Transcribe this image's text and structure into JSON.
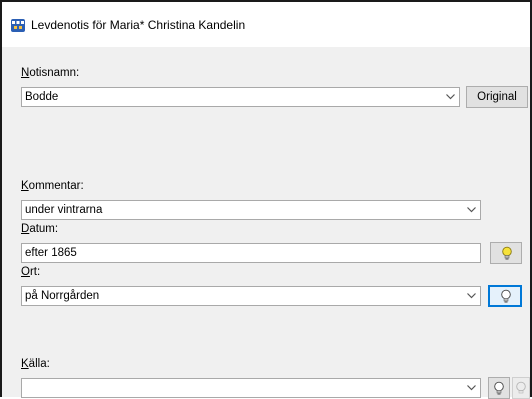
{
  "window": {
    "title": "Levdenotis för Maria* Christina Kandelin"
  },
  "fields": {
    "notisnamn": {
      "label_prefix": "N",
      "label_rest": "otisnamn:",
      "value": "Bodde",
      "button_label": "Original"
    },
    "kommentar": {
      "label_prefix": "K",
      "label_rest": "ommentar:",
      "value": "under vintrarna"
    },
    "datum": {
      "label_prefix": "D",
      "label_rest": "atum:",
      "value": "efter 1865"
    },
    "ort": {
      "label_prefix": "O",
      "label_rest": "rt:",
      "value": "på Norrgården"
    },
    "kalla": {
      "label_prefix": "K",
      "label_mid": "ä",
      "label_rest": "lla:",
      "value": ""
    }
  },
  "icons": {
    "app": "app-icon",
    "dropdown": "chevron-down-icon",
    "datum_button": "lightbulb-icon",
    "ort_button": "lightbulb-icon",
    "kalla_button": "lightbulb-icon",
    "kalla_button2": "disabled-lightbulb-icon"
  },
  "colors": {
    "frame": "#1a1a1a",
    "background": "#f0f0f0",
    "accent": "#0078d7",
    "bulb_lit": "#f6e23b"
  }
}
